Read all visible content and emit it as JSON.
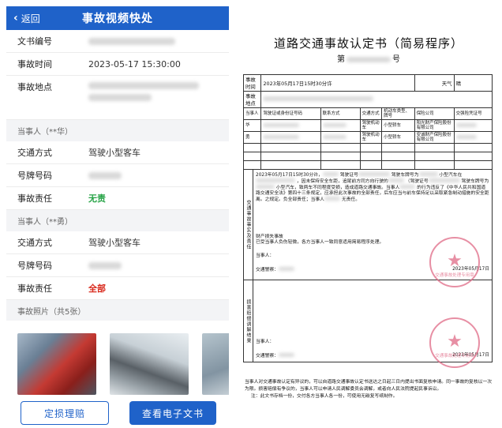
{
  "nav": {
    "back_label": "返回",
    "title": "事故视频快处"
  },
  "info": {
    "doc_no_label": "文书编号",
    "time_label": "事故时间",
    "time_value": "2023-05-17 15:30:00",
    "place_label": "事故地点"
  },
  "party1": {
    "section": "当事人（**华）",
    "transport_label": "交通方式",
    "transport_value": "驾驶小型客车",
    "plate_label": "号牌号码",
    "duty_label": "事故责任",
    "duty_value": "无责"
  },
  "party2": {
    "section": "当事人（**勇）",
    "transport_label": "交通方式",
    "transport_value": "驾驶小型客车",
    "plate_label": "号牌号码",
    "duty_label": "事故责任",
    "duty_value": "全部"
  },
  "photos": {
    "header": "事故照片（共5张）"
  },
  "buttons": {
    "assess": "定损理赔",
    "view_doc": "查看电子文书"
  },
  "colors": {
    "primary": "#1f62c9",
    "green": "#26a346",
    "red": "#d9291c",
    "stamp": "#e06a86"
  },
  "document": {
    "title": "道路交通事故认定书（简易程序）",
    "no_prefix": "第",
    "no_suffix": "号",
    "time_label": "事故时间",
    "time_value": "2023年05月17日15时30分许",
    "weather_label": "天气",
    "weather_value": "晴",
    "place_label": "事故地点",
    "headers": [
      "当事人",
      "驾驶证或身份证号码",
      "联系方式",
      "交通方式",
      "机动车类型、牌号",
      "保险公司",
      "交强险凭证号"
    ],
    "row1": {
      "party": "华",
      "transport": "驾驶机动车",
      "vehicle": "小型轿车",
      "insurer": "阳光财产保险股份有限公司"
    },
    "row2": {
      "party": "勇",
      "transport": "驾驶机动车",
      "vehicle": "小型轿车",
      "insurer": "安诚财产保险股份有限公司"
    },
    "side_facts": "交通事故事实及责任",
    "facts_line1": "2023年05月17日15时30分许，",
    "facts_line2": "驾驶证号",
    "facts_line3": "驾驶车牌号为",
    "facts_line4": "小型汽车在",
    "facts_line5": "，因未保持安全车距，追尾前方同方向行驶的",
    "facts_line6": "（驾驶证号",
    "facts_line7": "驾驶车牌号为",
    "facts_line8": "小型汽车，致两车不同程度受损，造成道路交通事故。当事人",
    "facts_line9": "的行为违反了《中华人民共和国道路交通安全法》第四十三条规定，应承担此次事故的全部责任，后车应当与前车保持足以采取紧急制动措施的安全距离。之规定。负全部责任；当事人",
    "facts_line10": "无责任。",
    "damage_title": "财产损失事故",
    "damage_text": "已受当事人负伤轻微，各方当事人一致同意适用简易程序处理。",
    "party_sign_label": "当事人：",
    "officer_label": "交通警察：",
    "date1": "2023年05月17日",
    "side_mediation": "损害赔偿调解结果",
    "party_sign_label2": "当事人：",
    "officer_label2": "交通警察：",
    "date2": "2023年05月17日",
    "foot1": "当事人对交通事故认定有异议的，可以自道路交通事故认定书送达之日起三日内提出书面复核申请。同一事故的复核以一次为限。损害赔偿有争议的，当事人可以申请人民调解委员会调解，或者向人民法院提起民事诉讼。",
    "foot2": "注：此文书存档一份，交付各方当事人各一份，可使用无碳复写纸制作。",
    "stamp_text": "交通事故处理专用章"
  }
}
